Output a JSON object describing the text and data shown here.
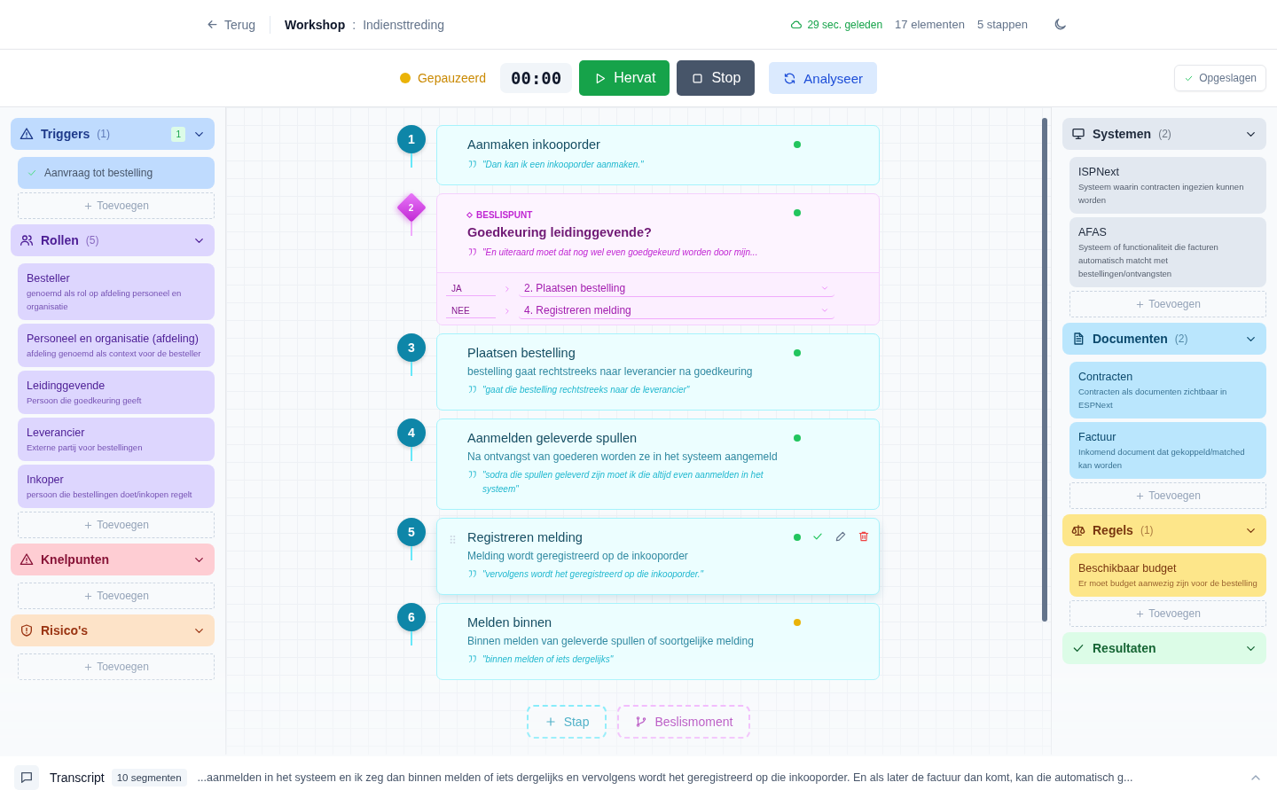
{
  "header": {
    "back": "Terug",
    "workshop": "Workshop",
    "separator": ":",
    "title": "Indiensttreding",
    "saved_ago": "29 sec. geleden",
    "elements": "17 elementen",
    "steps": "5 stappen"
  },
  "toolbar": {
    "status": "Gepauzeerd",
    "timer": "00:00",
    "buttons": [
      {
        "kind": "resume",
        "label": "Hervat"
      },
      {
        "kind": "stop",
        "label": "Stop"
      },
      {
        "kind": "analyze",
        "label": "Analyseer"
      }
    ],
    "saved": "Opgeslagen"
  },
  "left_sidebar": [
    {
      "kind": "triggers",
      "title": "Triggers",
      "count": "(1)",
      "badge": "1",
      "items": [
        {
          "title": "Aanvraag tot bestelling"
        }
      ],
      "add": "Toevoegen"
    },
    {
      "kind": "roles",
      "title": "Rollen",
      "count": "(5)",
      "items": [
        {
          "title": "Besteller",
          "description": "genoemd als rol op afdeling personeel en organisatie"
        },
        {
          "title": "Personeel en organisatie (afdeling)",
          "description": "afdeling genoemd als context voor de besteller"
        },
        {
          "title": "Leidinggevende",
          "description": "Persoon die goedkeuring geeft"
        },
        {
          "title": "Leverancier",
          "description": "Externe partij voor bestellingen"
        },
        {
          "title": "Inkoper",
          "description": "persoon die bestellingen doet/inkopen regelt"
        }
      ],
      "add": "Toevoegen"
    },
    {
      "kind": "issues",
      "title": "Knelpunten",
      "add": "Toevoegen"
    },
    {
      "kind": "risks",
      "title": "Risico's",
      "add": "Toevoegen"
    }
  ],
  "steps": [
    {
      "kind": "step",
      "number": "1",
      "title": "Aanmaken inkooporder",
      "quote": "\"Dan kan ik een inkooporder aanmaken.\"",
      "color": "#22c55e",
      "selected": false
    },
    {
      "kind": "decision",
      "number": "2",
      "label": "BESLISPUNT",
      "title": "Goedkeuring leidinggevende?",
      "quote": "\"En uiteraard moet dat nog wel even goedgekeurd worden door mijn...",
      "color": "#22c55e",
      "selected": false,
      "branches": [
        {
          "label": "JA",
          "target": "2. Plaatsen bestelling"
        },
        {
          "label": "NEE",
          "target": "4. Registreren melding"
        }
      ]
    },
    {
      "kind": "step",
      "number": "3",
      "title": "Plaatsen bestelling",
      "description": "bestelling gaat rechtstreeks naar leverancier na goedkeuring",
      "quote": "\"gaat die bestelling rechtstreeks naar de leverancier\"",
      "color": "#22c55e",
      "selected": false
    },
    {
      "kind": "step",
      "number": "4",
      "title": "Aanmelden geleverde spullen",
      "description": "Na ontvangst van goederen worden ze in het systeem aangemeld",
      "quote": "\"sodra die spullen geleverd zijn moet ik die altijd even aanmelden in het systeem\"",
      "color": "#22c55e",
      "selected": false
    },
    {
      "kind": "step",
      "number": "5",
      "title": "Registreren melding",
      "description": "Melding wordt geregistreerd op de inkooporder",
      "quote": "\"vervolgens wordt het geregistreerd op die inkooporder.\"",
      "color": "#22c55e",
      "selected": true
    },
    {
      "kind": "step",
      "number": "6",
      "title": "Melden binnen",
      "description": "Binnen melden van geleverde spullen of soortgelijke melding",
      "quote": "\"binnen melden of iets dergelijks\"",
      "color": "#eab308",
      "selected": false
    }
  ],
  "canvas_actions": [
    {
      "kind": "step",
      "label": "Stap"
    },
    {
      "kind": "decision",
      "label": "Beslismoment"
    }
  ],
  "right_sidebar": [
    {
      "kind": "systems",
      "title": "Systemen",
      "count": "(2)",
      "items": [
        {
          "title": "ISPNext",
          "description": "Systeem waarin contracten ingezien kunnen worden"
        },
        {
          "title": "AFAS",
          "description": "Systeem of functionaliteit die facturen automatisch matcht met bestellingen/ontvangsten"
        }
      ],
      "add": "Toevoegen"
    },
    {
      "kind": "documents",
      "title": "Documenten",
      "count": "(2)",
      "items": [
        {
          "title": "Contracten",
          "description": "Contracten als documenten zichtbaar in ESPNext"
        },
        {
          "title": "Factuur",
          "description": "Inkomend document dat gekoppeld/matched kan worden"
        }
      ],
      "add": "Toevoegen"
    },
    {
      "kind": "rules",
      "title": "Regels",
      "count": "(1)",
      "items": [
        {
          "title": "Beschikbaar budget",
          "description": "Er moet budget aanwezig zijn voor de bestelling"
        }
      ],
      "add": "Toevoegen"
    },
    {
      "kind": "results",
      "title": "Resultaten"
    }
  ],
  "transcript": {
    "title": "Transcript",
    "segments": "10 segmenten",
    "text": "...aanmelden in het systeem en ik zeg dan binnen melden of iets dergelijks en vervolgens wordt het geregistreerd op die inkooporder. En als later de factuur dan komt, kan die automatisch g..."
  }
}
